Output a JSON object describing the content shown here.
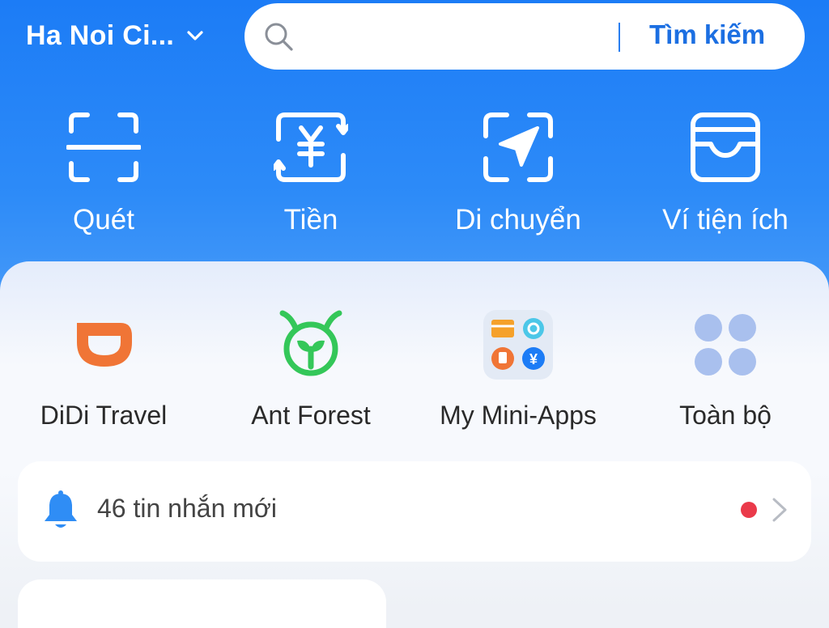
{
  "header": {
    "city": "Ha Noi Ci...",
    "search_placeholder": "",
    "search_button": "Tìm kiếm"
  },
  "quick_actions": [
    {
      "label": "Quét",
      "icon": "scan-icon"
    },
    {
      "label": "Tiền",
      "icon": "money-transfer-icon"
    },
    {
      "label": "Di chuyển",
      "icon": "navigation-icon"
    },
    {
      "label": "Ví tiện ích",
      "icon": "wallet-icon"
    }
  ],
  "apps": [
    {
      "label": "DiDi Travel",
      "icon": "didi-icon"
    },
    {
      "label": "Ant Forest",
      "icon": "ant-forest-icon"
    },
    {
      "label": "My Mini-Apps",
      "icon": "mini-apps-icon"
    },
    {
      "label": "Toàn bộ",
      "icon": "all-apps-icon"
    }
  ],
  "notification": {
    "text": "46 tin nhắn mới"
  },
  "colors": {
    "brand_blue": "#1c7cf6",
    "search_text": "#1c6fe2",
    "badge_red": "#ea3a4a",
    "didi_orange": "#f07536",
    "forest_green": "#34c759"
  }
}
